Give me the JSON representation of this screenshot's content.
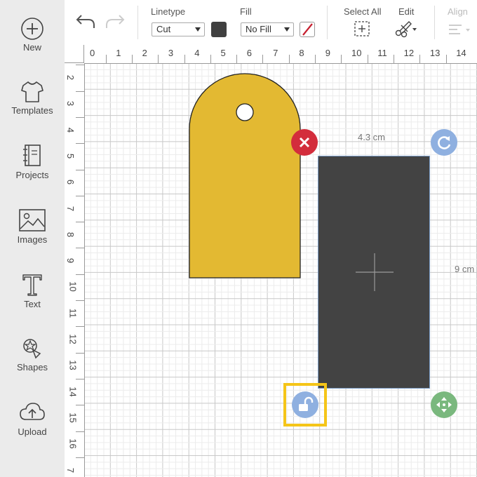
{
  "sidebar": {
    "items": [
      {
        "label": "New",
        "icon": "plus-circle-icon"
      },
      {
        "label": "Templates",
        "icon": "shirt-icon"
      },
      {
        "label": "Projects",
        "icon": "notebook-icon"
      },
      {
        "label": "Images",
        "icon": "image-icon"
      },
      {
        "label": "Text",
        "icon": "text-t-icon"
      },
      {
        "label": "Shapes",
        "icon": "shapes-icon"
      },
      {
        "label": "Upload",
        "icon": "cloud-upload-icon"
      }
    ]
  },
  "toolbar": {
    "undo_icon": "undo-icon",
    "redo_icon": "redo-icon",
    "linetype_label": "Linetype",
    "linetype_value": "Cut",
    "linetype_color": "#404040",
    "fill_label": "Fill",
    "fill_value": "No Fill",
    "select_all_label": "Select All",
    "edit_label": "Edit",
    "align_label": "Align"
  },
  "rulers": {
    "top": [
      "0",
      "1",
      "2",
      "3",
      "4",
      "5",
      "6",
      "7",
      "8",
      "9",
      "10",
      "11",
      "12",
      "13",
      "14"
    ],
    "left": [
      "2",
      "3",
      "4",
      "5",
      "6",
      "7",
      "8",
      "9",
      "10",
      "11",
      "12",
      "13",
      "14",
      "15",
      "16",
      "7"
    ]
  },
  "canvas": {
    "width_label": "4.3 cm",
    "height_label": "9 cm",
    "tag_color": "#e3b932",
    "rect_color": "#434343",
    "accent_red": "#d32d3c",
    "handle_blue": "#8fb0e0",
    "handle_green": "#7ab87e",
    "highlight_yellow": "#f5c518"
  }
}
